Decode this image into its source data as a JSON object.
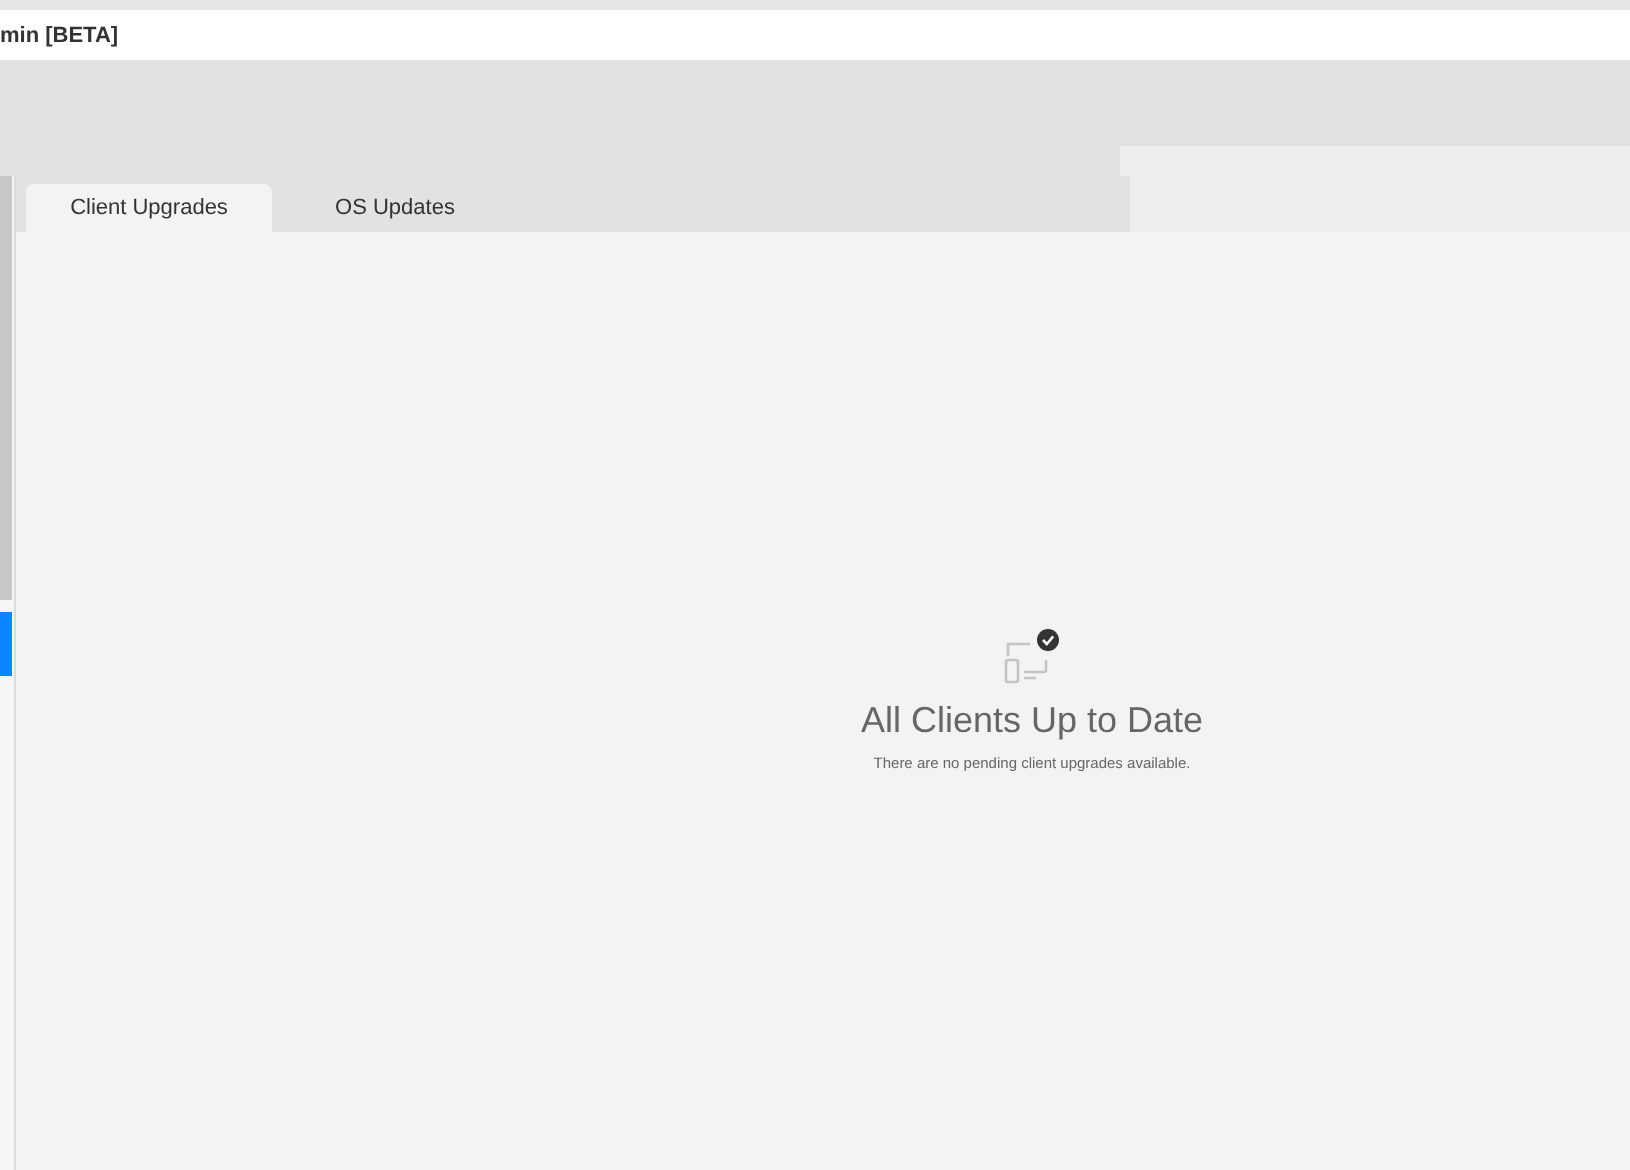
{
  "window": {
    "title": "min [BETA]"
  },
  "tabs": [
    {
      "label": "Client Upgrades",
      "selected": true
    },
    {
      "label": "OS Updates",
      "selected": false
    }
  ],
  "empty_state": {
    "title": "All Clients Up to Date",
    "message": "There are no pending client upgrades available."
  }
}
